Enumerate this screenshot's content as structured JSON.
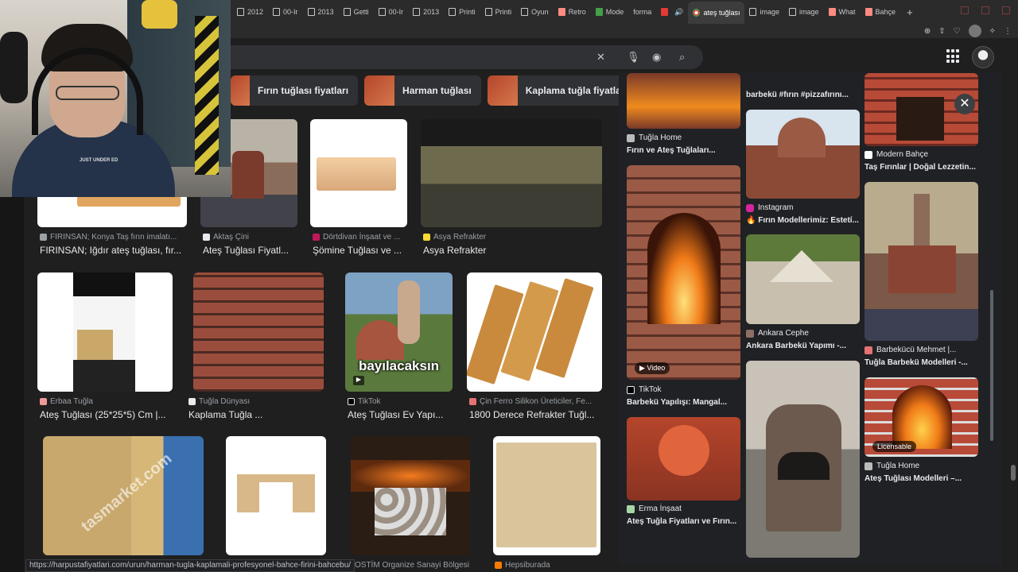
{
  "tabs": [
    {
      "label": "2012",
      "icon": "doc-icon"
    },
    {
      "label": "00-Ir",
      "icon": "doc-icon"
    },
    {
      "label": "2013",
      "icon": "doc-icon"
    },
    {
      "label": "Getti",
      "icon": "doc-icon"
    },
    {
      "label": "00-Ir",
      "icon": "doc-icon"
    },
    {
      "label": "2013",
      "icon": "drive-icon"
    },
    {
      "label": "Printi",
      "icon": "doc-icon"
    },
    {
      "label": "Printi",
      "icon": "doc-icon"
    },
    {
      "label": "Oyun",
      "icon": "gear-icon"
    },
    {
      "label": "Retro",
      "icon": "image-icon"
    },
    {
      "label": "Mode",
      "icon": "page-icon"
    },
    {
      "label": "forma",
      "icon": "none"
    },
    {
      "label": "",
      "icon": "youtube-icon"
    },
    {
      "label": "ateş tuğlası",
      "icon": "google-icon",
      "active": true
    },
    {
      "label": "image",
      "icon": "doc-icon"
    },
    {
      "label": "image",
      "icon": "doc-icon"
    },
    {
      "label": "What",
      "icon": "image-icon"
    },
    {
      "label": "Bahçe",
      "icon": "image-icon"
    }
  ],
  "new_tab_symbol": "+",
  "search": {
    "clear_symbol": "✕",
    "value": ""
  },
  "chips": [
    {
      "label": "Fırın tuğlası fiyatları"
    },
    {
      "label": "Harman tuğlası"
    },
    {
      "label": "Kaplama tuğla fiyatları"
    }
  ],
  "results": [
    {
      "source": "FIRINSAN; Konya Taş fırın imalatı...",
      "title": "FIRINSAN; Iğdır ateş tuğlası, fır..."
    },
    {
      "source": "Aktaş Çini",
      "title": "Ateş Tuğlası Fiyatl..."
    },
    {
      "source": "Dörtdivan İnşaat ve ...",
      "title": "Şömine Tuğlası ve ..."
    },
    {
      "source": "Asya Refrakter",
      "title": "Asya Refrakter"
    },
    {
      "source": "Erbaa Tuğla",
      "title": "Ateş Tuğlası (25*25*5) Cm |..."
    },
    {
      "source": "Tuğla Dünyası",
      "title": "Kaplama Tuğla ..."
    },
    {
      "source": "TikTok",
      "title": "Ateş Tuğlası Ev Yapı...",
      "overlay": "bayılacaksın"
    },
    {
      "source": "Çin Ferro Silikon Üreticiler, Fe...",
      "title": "1800 Derece Refrakter Tuğl..."
    },
    {
      "source": "OSTİM Organize Sanayi Bölgesi",
      "title": ""
    },
    {
      "source": "Hepsiburada",
      "title": ""
    }
  ],
  "watermark": "tasmarket.com",
  "panel": {
    "col1": [
      {
        "source": "Tuğla Home",
        "title": "Fırın ve Ateş Tuğlaları..."
      },
      {
        "source": "TikTok",
        "title": "Barbekü Yapılışı: Mangal...",
        "badge": "▶ Video"
      },
      {
        "source": "Erma İnşaat",
        "title": "Ateş Tuğla Fiyatları ve Fırın..."
      }
    ],
    "col2": [
      {
        "title_top": "barbekü #fırın #pizzafırını..."
      },
      {
        "source": "Instagram",
        "title": "🔥 Fırın Modellerimiz: Estetí..."
      },
      {
        "source": "Ankara Cephe",
        "title": "Ankara Barbekü Yapımı -..."
      }
    ],
    "col3": [
      {
        "source": "Modern Bahçe",
        "title": "Taş Fırınlar | Doğal Lezzetin..."
      },
      {
        "source": "Barbekücü Mehmet |...",
        "title": "Tuğla Barbekü Modelleri -..."
      },
      {
        "source": "Tuğla Home",
        "title": "Ateş Tuğlası Modelleri –...",
        "badge": "Licensable"
      }
    ],
    "close_symbol": "✕"
  },
  "status_url": "https://harpustafiyatlari.com/urun/harman-tugla-kaplamali-profesyonel-bahce-firini-bahcebu/",
  "webcam_shirt_text": "JUST UNDER ED"
}
